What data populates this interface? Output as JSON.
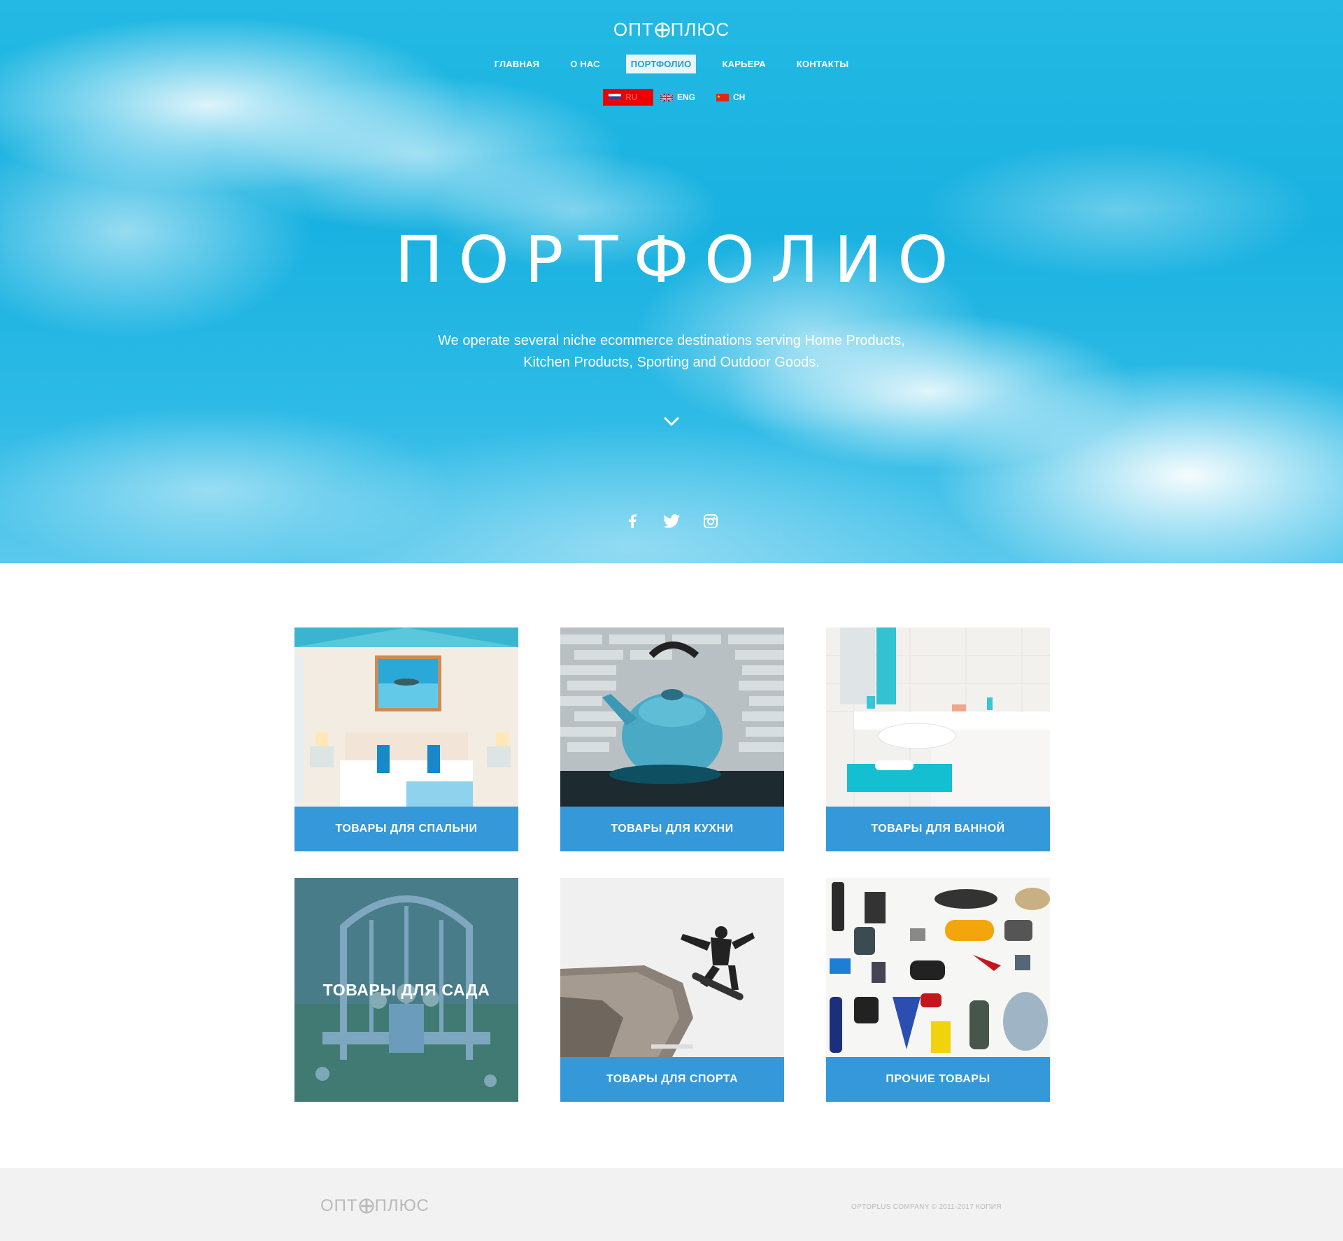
{
  "brand": {
    "logo_left": "ОПТ",
    "logo_right": "ПЛЮС"
  },
  "nav": {
    "items": [
      {
        "label": "ГЛАВНАЯ",
        "active": false
      },
      {
        "label": "О НАС",
        "active": false
      },
      {
        "label": "ПОРТФОЛИО",
        "active": true
      },
      {
        "label": "КАРЬЕРА",
        "active": false
      },
      {
        "label": "КОНТАКТЫ",
        "active": false
      }
    ]
  },
  "languages": [
    {
      "code": "RU",
      "active": true,
      "flag": "russia-flag"
    },
    {
      "code": "ENG",
      "active": false,
      "flag": "uk-flag"
    },
    {
      "code": "CH",
      "active": false,
      "flag": "china-flag"
    }
  ],
  "hero": {
    "title": "ПОРТФОЛИО",
    "subtitle_line1": "We operate several niche ecommerce destinations serving Home Products,",
    "subtitle_line2": "Kitchen Products, Sporting and Outdoor Goods."
  },
  "social_icons": [
    "facebook-icon",
    "twitter-icon",
    "instagram-icon"
  ],
  "portfolio": [
    {
      "label": "ТОВАРЫ ДЛЯ СПАЛЬНИ",
      "image": "bedroom-photo"
    },
    {
      "label": "ТОВАРЫ ДЛЯ КУХНИ",
      "image": "kettle-photo"
    },
    {
      "label": "ТОВАРЫ ДЛЯ ВАННОЙ",
      "image": "bathroom-photo"
    },
    {
      "label": "ТОВАРЫ ДЛЯ САДА",
      "image": "garden-chair-photo"
    },
    {
      "label": "ТОВАРЫ ДЛЯ СПОРТА",
      "image": "snowboarder-photo"
    },
    {
      "label": "ПРОЧИЕ ТОВАРЫ",
      "image": "camping-gear-photo"
    }
  ],
  "footer": {
    "logo_left": "ОПТ",
    "logo_right": "ПЛЮС",
    "copyright": "OPTOPLUS COMPANY © 2011-2017 КОПИЯ"
  },
  "colors": {
    "sky": "#1fb4e2",
    "caption_blue": "#3498d9",
    "lang_active": "#ee0000",
    "footer_bg": "#f2f2f2"
  }
}
